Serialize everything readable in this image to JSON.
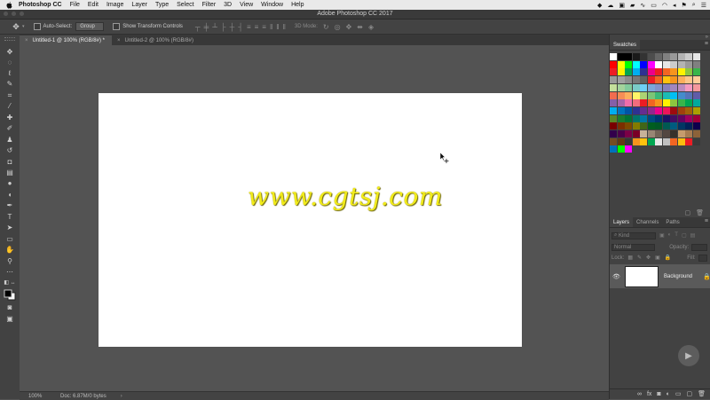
{
  "menubar": {
    "apple_glyph": "",
    "items": [
      "Photoshop CC",
      "File",
      "Edit",
      "Image",
      "Layer",
      "Type",
      "Select",
      "Filter",
      "3D",
      "View",
      "Window",
      "Help"
    ],
    "tray_icons": [
      "dropbox-icon",
      "cloud-icon",
      "bag-icon",
      "car-icon",
      "wave-icon",
      "display-icon",
      "wifi-icon",
      "volume-icon",
      "flag-icon",
      "search-icon",
      "menu-icon"
    ]
  },
  "window": {
    "title": "Adobe Photoshop CC 2017"
  },
  "options": {
    "auto_select_label": "Auto-Select:",
    "auto_select_value": "Group",
    "transform_label": "Show Transform Controls",
    "mode_3d": "3D Mode:"
  },
  "tabs": [
    {
      "label": "Untitled-1 @ 100% (RGB/8#) *",
      "close": "×"
    },
    {
      "label": "Untitled-2 @ 100% (RGB/8#)",
      "close": "×"
    }
  ],
  "document": {
    "text": "www.cgtsj.com"
  },
  "status": {
    "zoom": "100%",
    "doc": "Doc: 6.87M/0 bytes",
    "arrow": "›"
  },
  "swatches": {
    "title": "Swatches",
    "rows": [
      [
        "#ffffff",
        "#000000",
        "#000000",
        "#1a1a1a",
        "#333333",
        "#4d4d4d",
        "#666666",
        "#808080",
        "#999999",
        "#b3b3b3",
        "#cccccc",
        "#e6e6e6"
      ],
      [
        "#ff0000",
        "#ffff00",
        "#00ff00",
        "#00ffff",
        "#0000ff",
        "#ff00ff",
        "#ffffff",
        "#e6e6e6",
        "#cccccc",
        "#b3b3b3",
        "#999999",
        "#808080"
      ],
      [
        "#ee1c24",
        "#fff200",
        "#00a651",
        "#00aeef",
        "#2e3192",
        "#ec008c",
        "#ed1c24",
        "#f26522",
        "#f7941d",
        "#fff200",
        "#8dc63f",
        "#39b54a"
      ],
      [
        "#999999",
        "#a0a0a0",
        "#8c8c8c",
        "#777777",
        "#606060",
        "#ed1c24",
        "#f26522",
        "#ffc20e",
        "#f7941d",
        "#fbaf5d",
        "#fdc689",
        "#ffcc99"
      ],
      [
        "#c4df9b",
        "#a3d39c",
        "#82ca9c",
        "#7accc8",
        "#6dcff6",
        "#7da7d9",
        "#8393ca",
        "#8781bd",
        "#a186be",
        "#bd8cbf",
        "#f49ac1",
        "#f5989d"
      ],
      [
        "#f26c4f",
        "#f68e56",
        "#fbaf5d",
        "#fff568",
        "#acd373",
        "#7cc576",
        "#3cb878",
        "#1cbbb4",
        "#00bff3",
        "#448ccb",
        "#5574b9",
        "#605ca8"
      ],
      [
        "#855fa8",
        "#a864a8",
        "#f06eaa",
        "#f26d7d",
        "#ed1c24",
        "#f26522",
        "#f7941d",
        "#fff200",
        "#8dc63f",
        "#39b54a",
        "#00a651",
        "#00a99d"
      ],
      [
        "#00aeef",
        "#0072bc",
        "#0054a6",
        "#2e3192",
        "#662d91",
        "#92278f",
        "#ec008c",
        "#ed145b",
        "#9e0b0f",
        "#a0410d",
        "#a36209",
        "#aba000"
      ],
      [
        "#598527",
        "#1a7b30",
        "#007236",
        "#00746b",
        "#0076a3",
        "#004a80",
        "#003471",
        "#1b1464",
        "#440e62",
        "#630460",
        "#9e005d",
        "#9e0039"
      ],
      [
        "#790000",
        "#7b2e00",
        "#7d4900",
        "#827b00",
        "#406618",
        "#005e20",
        "#005826",
        "#005952",
        "#005b7f",
        "#003663",
        "#002157",
        "#0d004c"
      ],
      [
        "#32004b",
        "#4b0049",
        "#7b0046",
        "#7a0026",
        "#c7b299",
        "#998675",
        "#736357",
        "#534741",
        "#37302a",
        "#c69c6d",
        "#a67c52",
        "#8c6239"
      ],
      [
        "#754c24",
        "#603913",
        "#363636",
        "#f7941d",
        "#ffc20e",
        "#00a651",
        "#e6e6e6",
        "#c0c0c0",
        "#f26522",
        "#fdbd10",
        "#ed1c24",
        "#3a3a3a"
      ],
      [
        "#0072bc",
        "#00ff00",
        "#ff00ff"
      ]
    ]
  },
  "layers": {
    "tabs": [
      "Layers",
      "Channels",
      "Paths"
    ],
    "kind_placeholder": "Kind",
    "blend_mode": "Normal",
    "opacity_label": "Opacity:",
    "lock_label": "Lock:",
    "fill_label": "Fill:",
    "layer_name": "Background"
  }
}
